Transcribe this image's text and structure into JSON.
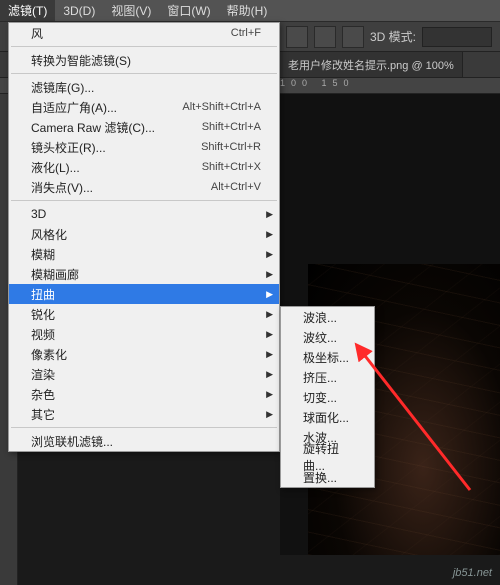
{
  "menubar": {
    "items": [
      {
        "label": "滤镜(T)",
        "active": true
      },
      {
        "label": "3D(D)",
        "active": false
      },
      {
        "label": "视图(V)",
        "active": false
      },
      {
        "label": "窗口(W)",
        "active": false
      },
      {
        "label": "帮助(H)",
        "active": false
      }
    ]
  },
  "toolbar": {
    "mode_label": "3D 模式:"
  },
  "doc_tab": {
    "title": "老用户修改姓名提示.png @ 100%"
  },
  "ruler_text": "100  150",
  "filter_menu": {
    "last_filter": {
      "label": "风",
      "shortcut": "Ctrl+F"
    },
    "convert": {
      "label": "转换为智能滤镜(S)"
    },
    "group1": [
      {
        "label": "滤镜库(G)...",
        "shortcut": ""
      },
      {
        "label": "自适应广角(A)...",
        "shortcut": "Alt+Shift+Ctrl+A"
      },
      {
        "label": "Camera Raw 滤镜(C)...",
        "shortcut": "Shift+Ctrl+A"
      },
      {
        "label": "镜头校正(R)...",
        "shortcut": "Shift+Ctrl+R"
      },
      {
        "label": "液化(L)...",
        "shortcut": "Shift+Ctrl+X"
      },
      {
        "label": "消失点(V)...",
        "shortcut": "Alt+Ctrl+V"
      }
    ],
    "group2": [
      {
        "label": "3D"
      },
      {
        "label": "风格化"
      },
      {
        "label": "模糊"
      },
      {
        "label": "模糊画廊"
      },
      {
        "label": "扭曲",
        "highlight": true
      },
      {
        "label": "锐化"
      },
      {
        "label": "视频"
      },
      {
        "label": "像素化"
      },
      {
        "label": "渲染"
      },
      {
        "label": "杂色"
      },
      {
        "label": "其它"
      }
    ],
    "browse": {
      "label": "浏览联机滤镜..."
    }
  },
  "distort_submenu": [
    {
      "label": "波浪..."
    },
    {
      "label": "波纹..."
    },
    {
      "label": "极坐标..."
    },
    {
      "label": "挤压..."
    },
    {
      "label": "切变..."
    },
    {
      "label": "球面化..."
    },
    {
      "label": "水波..."
    },
    {
      "label": "旋转扭曲..."
    },
    {
      "label": "置换..."
    }
  ],
  "annotation": {
    "color": "#ff2a2a"
  },
  "watermark": "jb51.net"
}
